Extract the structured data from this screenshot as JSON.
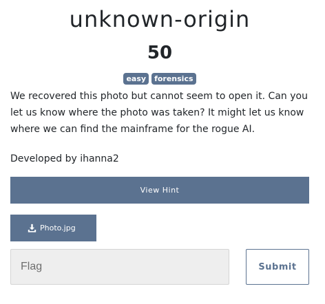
{
  "challenge": {
    "name": "unknown-origin",
    "value": "50",
    "tags": [
      "easy",
      "forensics"
    ],
    "description": "We recovered this photo but cannot seem to open it. Can you let us know where the photo was taken? It might let us know where we can find the mainframe for the rogue AI.",
    "author": "Developed by ihanna2"
  },
  "hint": {
    "label": "View Hint"
  },
  "files": [
    {
      "label": "Photo.jpg",
      "icon": "download-icon"
    }
  ],
  "submission": {
    "flag_placeholder": "Flag",
    "flag_value": "",
    "submit_label": "Submit"
  },
  "colors": {
    "accent": "#5b7290",
    "input_background": "#eeeeee"
  }
}
